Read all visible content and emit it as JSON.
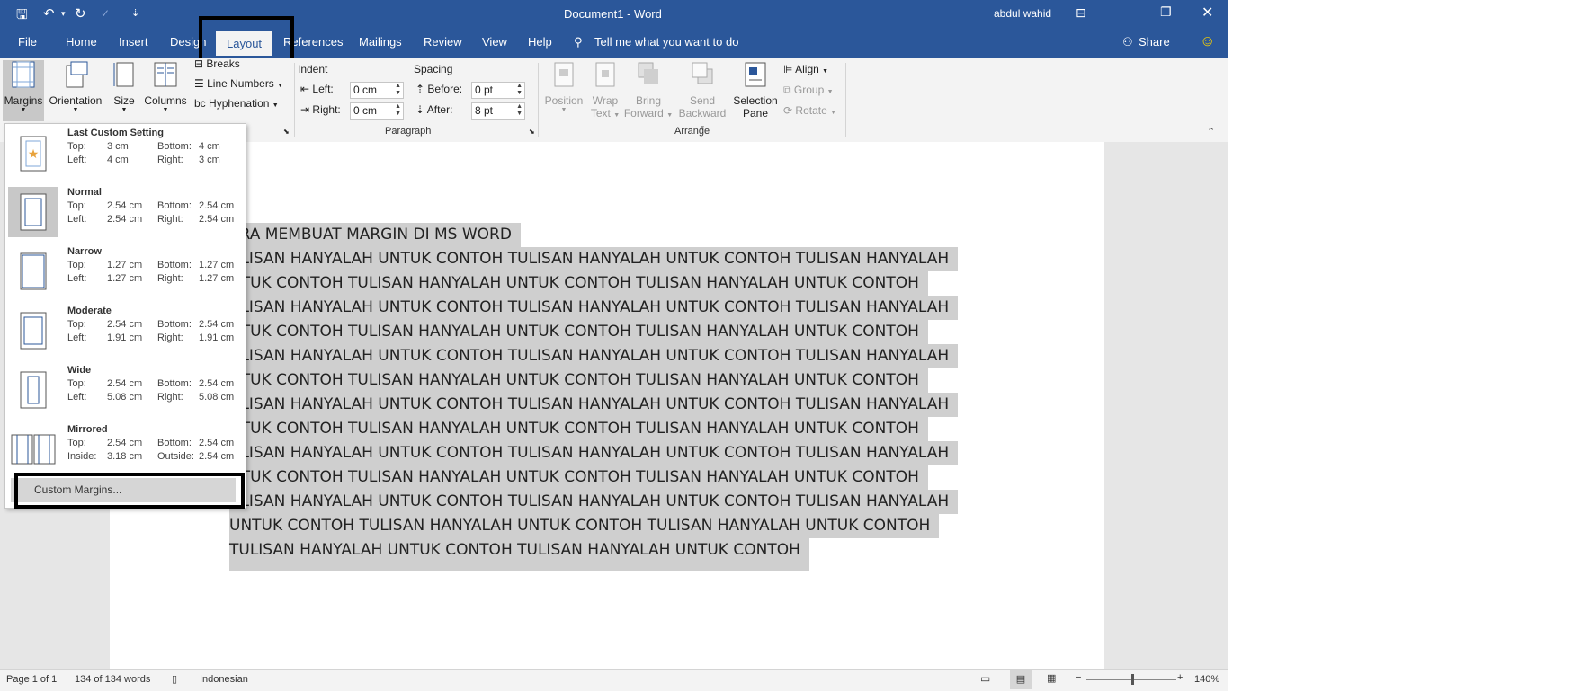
{
  "window": {
    "title": "Document1 - Word",
    "user": "abdul wahid"
  },
  "tabs": [
    "File",
    "Home",
    "Insert",
    "Design",
    "Layout",
    "References",
    "Mailings",
    "Review",
    "View",
    "Help"
  ],
  "active_tab": "Layout",
  "tell_me": "Tell me what you want to do",
  "share": "Share",
  "ribbon": {
    "page_setup": {
      "margins": "Margins",
      "orientation": "Orientation",
      "size": "Size",
      "columns": "Columns",
      "breaks": "Breaks",
      "line_numbers": "Line Numbers",
      "hyphenation": "Hyphenation"
    },
    "paragraph": {
      "label": "Paragraph",
      "indent": "Indent",
      "left_label": "Left:",
      "left_value": "0 cm",
      "right_label": "Right:",
      "right_value": "0 cm",
      "spacing": "Spacing",
      "before_label": "Before:",
      "before_value": "0 pt",
      "after_label": "After:",
      "after_value": "8 pt"
    },
    "arrange": {
      "label": "Arrange",
      "position": "Position",
      "wrap_text_1": "Wrap",
      "wrap_text_2": "Text",
      "bring_forward_1": "Bring",
      "bring_forward_2": "Forward",
      "send_backward_1": "Send",
      "send_backward_2": "Backward",
      "selection_pane_1": "Selection",
      "selection_pane_2": "Pane",
      "align": "Align",
      "group": "Group",
      "rotate": "Rotate"
    }
  },
  "margins_menu": {
    "items": [
      {
        "name": "Last Custom Setting",
        "k1": "Top:",
        "v1": "3 cm",
        "k2": "Bottom:",
        "v2": "4 cm",
        "k3": "Left:",
        "v3": "4 cm",
        "k4": "Right:",
        "v4": "3 cm"
      },
      {
        "name": "Normal",
        "k1": "Top:",
        "v1": "2.54 cm",
        "k2": "Bottom:",
        "v2": "2.54 cm",
        "k3": "Left:",
        "v3": "2.54 cm",
        "k4": "Right:",
        "v4": "2.54 cm"
      },
      {
        "name": "Narrow",
        "k1": "Top:",
        "v1": "1.27 cm",
        "k2": "Bottom:",
        "v2": "1.27 cm",
        "k3": "Left:",
        "v3": "1.27 cm",
        "k4": "Right:",
        "v4": "1.27 cm"
      },
      {
        "name": "Moderate",
        "k1": "Top:",
        "v1": "2.54 cm",
        "k2": "Bottom:",
        "v2": "2.54 cm",
        "k3": "Left:",
        "v3": "1.91 cm",
        "k4": "Right:",
        "v4": "1.91 cm"
      },
      {
        "name": "Wide",
        "k1": "Top:",
        "v1": "2.54 cm",
        "k2": "Bottom:",
        "v2": "2.54 cm",
        "k3": "Left:",
        "v3": "5.08 cm",
        "k4": "Right:",
        "v4": "5.08 cm"
      },
      {
        "name": "Mirrored",
        "k1": "Top:",
        "v1": "2.54 cm",
        "k2": "Bottom:",
        "v2": "2.54 cm",
        "k3": "Inside:",
        "v3": "3.18 cm",
        "k4": "Outside:",
        "v4": "2.54 cm"
      }
    ],
    "selected": "Normal",
    "custom": "Custom Margins..."
  },
  "document": {
    "lines": [
      "ARA MEMBUAT MARGIN DI MS WORD",
      "ULISAN HANYALAH UNTUK CONTOH TULISAN HANYALAH UNTUK CONTOH TULISAN HANYALAH",
      "NTUK CONTOH TULISAN HANYALAH UNTUK CONTOH TULISAN HANYALAH UNTUK CONTOH",
      "ULISAN HANYALAH UNTUK CONTOH TULISAN HANYALAH UNTUK CONTOH TULISAN HANYALAH",
      "NTUK CONTOH TULISAN HANYALAH UNTUK CONTOH TULISAN HANYALAH UNTUK CONTOH",
      "ULISAN HANYALAH UNTUK CONTOH TULISAN HANYALAH UNTUK CONTOH TULISAN HANYALAH",
      "NTUK CONTOH TULISAN HANYALAH UNTUK CONTOH TULISAN HANYALAH UNTUK CONTOH",
      "ULISAN HANYALAH UNTUK CONTOH TULISAN HANYALAH UNTUK CONTOH TULISAN HANYALAH",
      "NTUK CONTOH TULISAN HANYALAH UNTUK CONTOH TULISAN HANYALAH UNTUK CONTOH",
      "ULISAN HANYALAH UNTUK CONTOH TULISAN HANYALAH UNTUK CONTOH TULISAN HANYALAH",
      "NTUK CONTOH TULISAN HANYALAH UNTUK CONTOH TULISAN HANYALAH UNTUK CONTOH",
      "ULISAN HANYALAH UNTUK CONTOH TULISAN HANYALAH UNTUK CONTOH TULISAN HANYALAH",
      "UNTUK CONTOH TULISAN HANYALAH UNTUK CONTOH TULISAN HANYALAH UNTUK CONTOH",
      "TULISAN HANYALAH UNTUK CONTOH TULISAN HANYALAH UNTUK CONTOH"
    ]
  },
  "status": {
    "page": "Page 1 of 1",
    "words": "134 of 134 words",
    "language": "Indonesian",
    "zoom": "140%"
  },
  "colors": {
    "accent": "#2b579a",
    "selection": "#cfcfcf"
  }
}
